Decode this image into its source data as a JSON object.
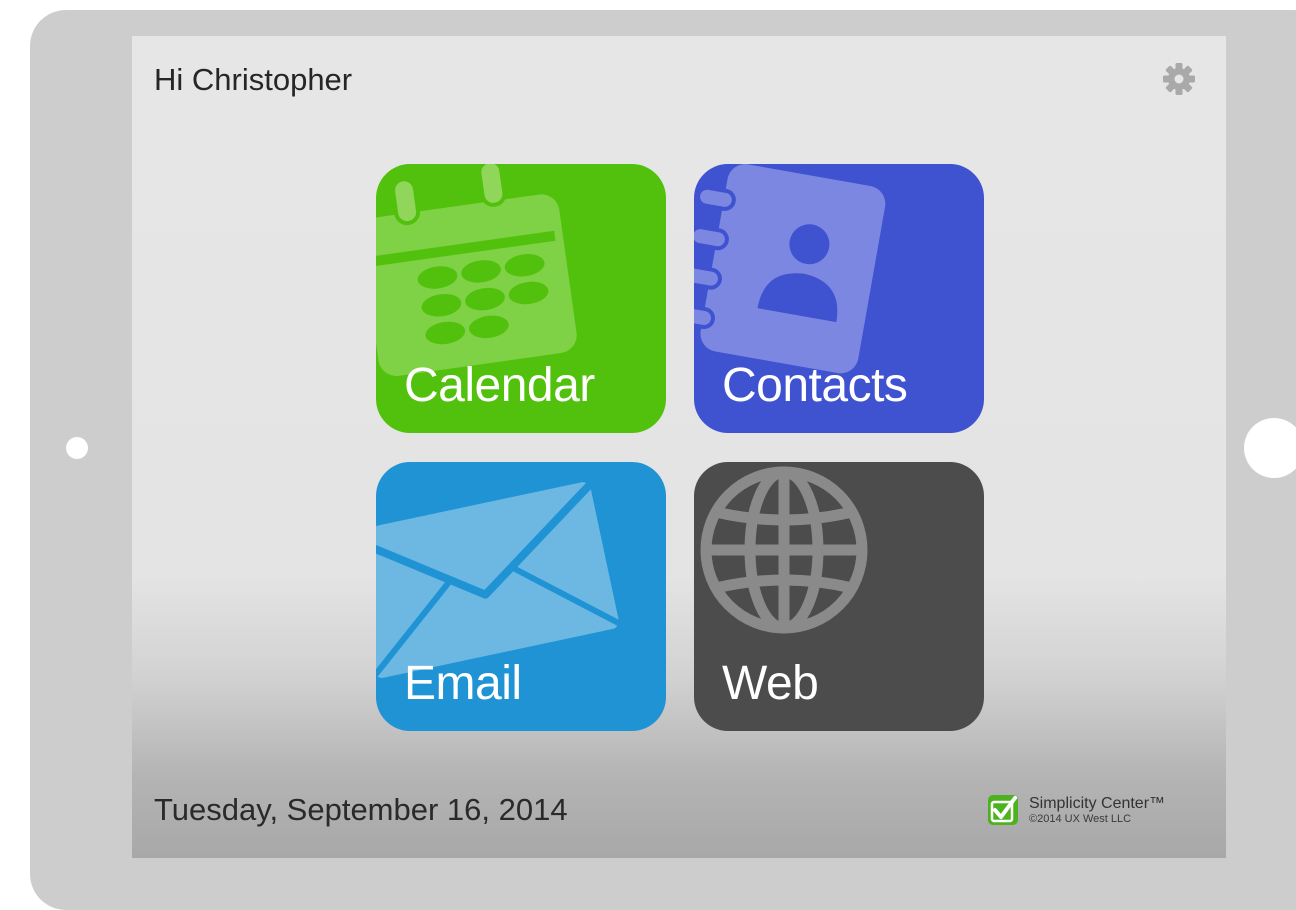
{
  "header": {
    "greeting": "Hi Christopher",
    "settings_icon": "gear-icon"
  },
  "tiles": [
    {
      "id": "calendar",
      "label": "Calendar",
      "icon": "calendar-icon",
      "color": "#52c10d"
    },
    {
      "id": "contacts",
      "label": "Contacts",
      "icon": "address-book-icon",
      "color": "#3f52cf"
    },
    {
      "id": "email",
      "label": "Email",
      "icon": "envelope-icon",
      "color": "#1f93d3"
    },
    {
      "id": "web",
      "label": "Web",
      "icon": "globe-icon",
      "color": "#4c4c4c"
    }
  ],
  "footer": {
    "date": "Tuesday, September 16, 2014",
    "brand_name": "Simplicity Center™",
    "brand_copyright": "©2014 UX West LLC",
    "brand_icon": "checkmark-logo-icon"
  },
  "colors": {
    "frame": "#cdcdcd",
    "screen": "#e6e6e6"
  }
}
